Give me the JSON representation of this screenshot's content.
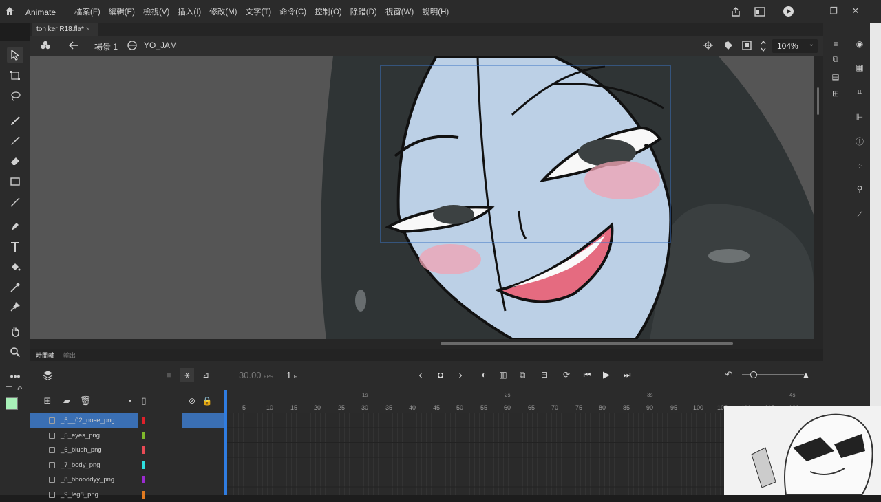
{
  "app": {
    "name": "Animate"
  },
  "menu": [
    "檔案(F)",
    "編輯(E)",
    "檢視(V)",
    "插入(I)",
    "修改(M)",
    "文字(T)",
    "命令(C)",
    "控制(O)",
    "除錯(D)",
    "視窗(W)",
    "說明(H)"
  ],
  "document": {
    "tab_title": "ton ker R18.fla*",
    "close_glyph": "×"
  },
  "edit_bar": {
    "scene": "場景 1",
    "symbol": "YO_JAM",
    "zoom": "104%"
  },
  "timeline": {
    "tab_label": "時間軸",
    "output_label": "輸出",
    "fps": "30.00",
    "fps_unit": "FPS",
    "frame": "1",
    "frame_unit": "F",
    "ruler_ticks": [
      "5",
      "10",
      "15",
      "20",
      "25",
      "30",
      "35",
      "40",
      "45",
      "50",
      "55",
      "60",
      "65",
      "70",
      "75",
      "80",
      "85",
      "90",
      "95",
      "100",
      "105",
      "110",
      "115",
      "120"
    ],
    "seconds": [
      "1s",
      "2s",
      "3s",
      "4s"
    ]
  },
  "layers": [
    {
      "name": "_5__02_nose_png",
      "color": "#e0202a",
      "selected": true
    },
    {
      "name": "_5_eyes_png",
      "color": "#7fb92b",
      "selected": false
    },
    {
      "name": "_6_blush_png",
      "color": "#e84a55",
      "selected": false
    },
    {
      "name": "_7_body_png",
      "color": "#2ee0e0",
      "selected": false
    },
    {
      "name": "_8_bbooddyy_png",
      "color": "#9b2bd0",
      "selected": false
    },
    {
      "name": "_9_leg8_png",
      "color": "#e07a20",
      "selected": false
    }
  ],
  "icons": {
    "tools": [
      "selection-icon",
      "free-transform-icon",
      "lasso-icon",
      "paint-brush-icon",
      "brush-icon",
      "eraser-icon",
      "rectangle-icon",
      "line-icon",
      "pen-icon",
      "text-icon",
      "paint-bucket-icon",
      "eyedropper-icon",
      "pin-icon",
      "hand-icon",
      "zoom-icon",
      "more-icon"
    ]
  },
  "colors": {
    "fill_swatch": "#a8f0b8",
    "stroke_swatch": "#000000",
    "accent": "#3a6fb4",
    "playhead": "#2f7ce0"
  }
}
